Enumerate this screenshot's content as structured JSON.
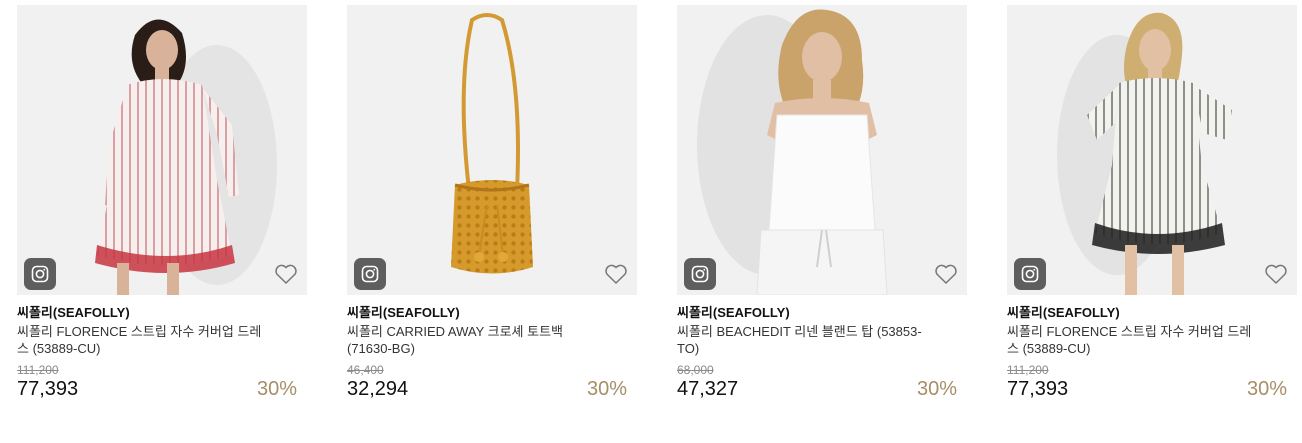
{
  "colors": {
    "accent_discount": "#a68e67",
    "badge_bg": "#5e5e5e",
    "image_bg": "#f1f1f1"
  },
  "products": [
    {
      "brand": "씨폴리(SEAFOLLY)",
      "name": "씨폴리 FLORENCE 스트립 자수 커버업 드레스 (53889-CU)",
      "original_price": "111,200",
      "price": "77,393",
      "discount": "30%",
      "image_icon": "dress-red-stripe-icon",
      "badge_icon": "camera-icon",
      "wish_icon": "heart-outline-icon"
    },
    {
      "brand": "씨폴리(SEAFOLLY)",
      "name": "씨폴리 CARRIED AWAY 크로셰 토트백 (71630-BG)",
      "original_price": "46,400",
      "price": "32,294",
      "discount": "30%",
      "image_icon": "crochet-bag-icon",
      "badge_icon": "camera-icon",
      "wish_icon": "heart-outline-icon"
    },
    {
      "brand": "씨폴리(SEAFOLLY)",
      "name": "씨폴리 BEACHEDIT 리넨 블랜드 탑 (53853-TO)",
      "original_price": "68,000",
      "price": "47,327",
      "discount": "30%",
      "image_icon": "white-cami-top-icon",
      "badge_icon": "camera-icon",
      "wish_icon": "heart-outline-icon"
    },
    {
      "brand": "씨폴리(SEAFOLLY)",
      "name": "씨폴리 FLORENCE 스트립 자수 커버업 드레스 (53889-CU)",
      "original_price": "111,200",
      "price": "77,393",
      "discount": "30%",
      "image_icon": "dress-black-stripe-icon",
      "badge_icon": "camera-icon",
      "wish_icon": "heart-outline-icon"
    }
  ]
}
